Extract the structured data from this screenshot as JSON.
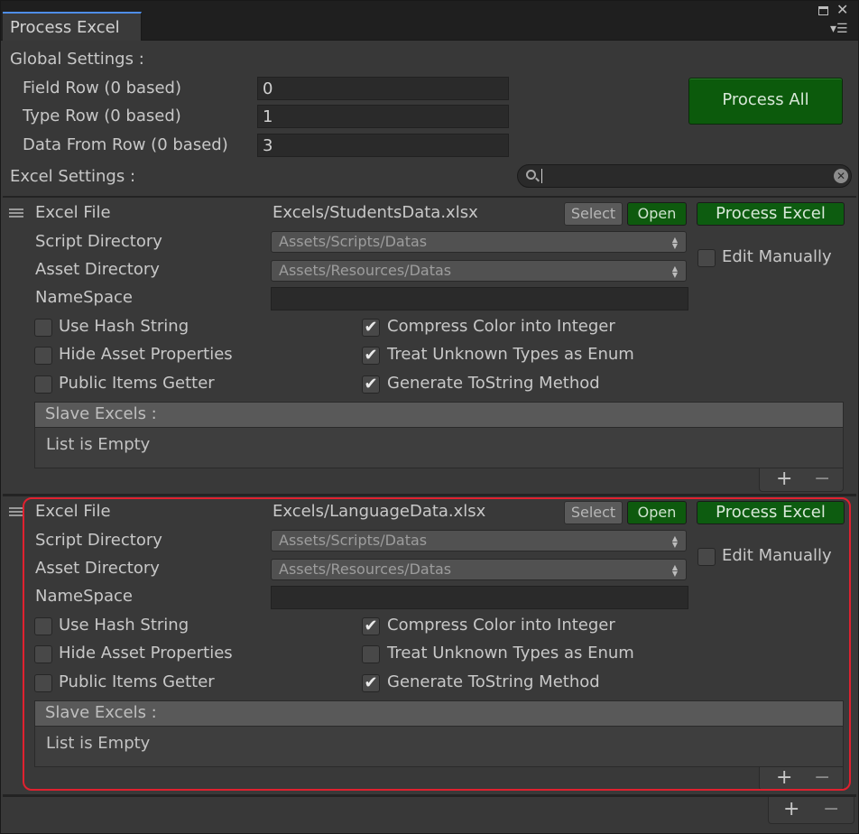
{
  "window": {
    "tab_title": "Process Excel",
    "maximize_icon": "maximize-icon",
    "close_icon": "close-icon",
    "menu_icon": "hamburger-menu-icon"
  },
  "global": {
    "heading": "Global Settings :",
    "field_row_label": "Field Row (0 based)",
    "field_row_value": "0",
    "type_row_label": "Type Row (0 based)",
    "type_row_value": "1",
    "data_row_label": "Data From Row (0 based)",
    "data_row_value": "3",
    "process_all_label": "Process All"
  },
  "excel_settings": {
    "heading": "Excel Settings :",
    "search_value": ""
  },
  "entries": [
    {
      "excel_file_label": "Excel File",
      "excel_file_value": "Excels/StudentsData.xlsx",
      "select_label": "Select",
      "open_label": "Open",
      "process_label": "Process Excel",
      "script_dir_label": "Script Directory",
      "script_dir_value": "Assets/Scripts/Datas",
      "asset_dir_label": "Asset Directory",
      "asset_dir_value": "Assets/Resources/Datas",
      "edit_manually_label": "Edit Manually",
      "namespace_label": "NameSpace",
      "namespace_value": "",
      "use_hash_label": "Use Hash String",
      "hide_asset_label": "Hide Asset Properties",
      "public_items_label": "Public Items Getter",
      "compress_color_label": "Compress Color into Integer",
      "treat_unknown_label": "Treat Unknown Types as Enum",
      "gen_tostring_label": "Generate ToString Method",
      "slave_heading": "Slave Excels :",
      "slave_empty": "List is Empty"
    },
    {
      "excel_file_label": "Excel File",
      "excel_file_value": "Excels/LanguageData.xlsx",
      "select_label": "Select",
      "open_label": "Open",
      "process_label": "Process Excel",
      "script_dir_label": "Script Directory",
      "script_dir_value": "Assets/Scripts/Datas",
      "asset_dir_label": "Asset Directory",
      "asset_dir_value": "Assets/Resources/Datas",
      "edit_manually_label": "Edit Manually",
      "namespace_label": "NameSpace",
      "namespace_value": "",
      "use_hash_label": "Use Hash String",
      "hide_asset_label": "Hide Asset Properties",
      "public_items_label": "Public Items Getter",
      "compress_color_label": "Compress Color into Integer",
      "treat_unknown_label": "Treat Unknown Types as Enum",
      "gen_tostring_label": "Generate ToString Method",
      "slave_heading": "Slave Excels :",
      "slave_empty": "List is Empty"
    }
  ],
  "checkbox_states": {
    "entry0": {
      "use_hash": false,
      "hide_asset": false,
      "public_items": false,
      "compress_color": true,
      "treat_unknown": true,
      "gen_tostring": true,
      "edit_manually": false
    },
    "entry1": {
      "use_hash": false,
      "hide_asset": false,
      "public_items": false,
      "compress_color": true,
      "treat_unknown": false,
      "gen_tostring": true,
      "edit_manually": false
    }
  },
  "glyphs": {
    "plus": "+",
    "minus": "−",
    "check": "✔",
    "arrows": "▲▼"
  },
  "colors": {
    "accent_green": "#0e5a0e",
    "highlight_red": "#e0212f",
    "tab_accent": "#4f8ee8"
  }
}
